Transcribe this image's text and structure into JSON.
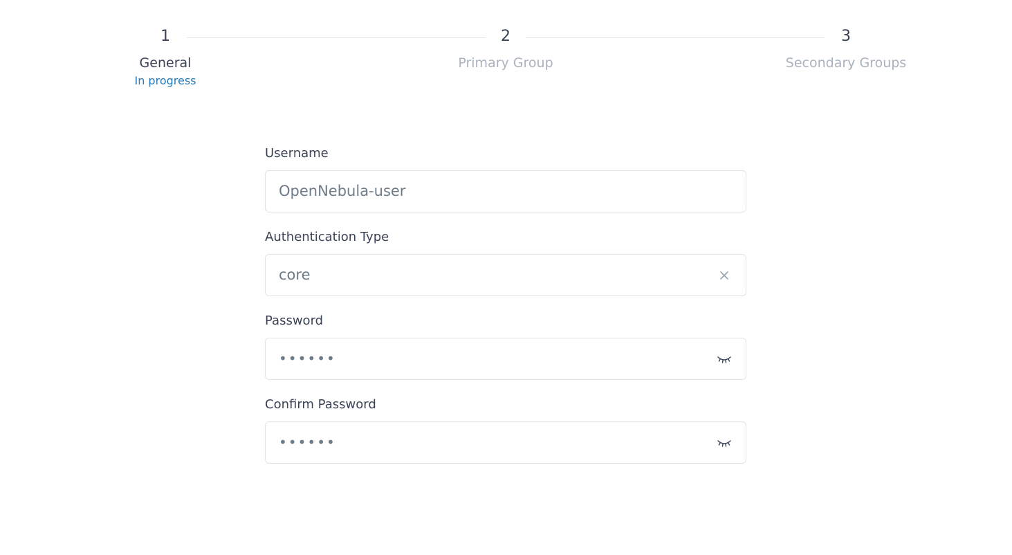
{
  "stepper": {
    "steps": [
      {
        "number": "1",
        "title": "General",
        "status": "In progress"
      },
      {
        "number": "2",
        "title": "Primary Group"
      },
      {
        "number": "3",
        "title": "Secondary Groups"
      }
    ]
  },
  "form": {
    "username": {
      "label": "Username",
      "value": "OpenNebula-user"
    },
    "auth_type": {
      "label": "Authentication Type",
      "value": "core",
      "icon": "close-icon"
    },
    "password": {
      "label": "Password",
      "value": "••••••",
      "icon": "eye-closed-icon"
    },
    "confirm_password": {
      "label": "Confirm Password",
      "value": "••••••",
      "icon": "eye-closed-icon"
    }
  },
  "colors": {
    "text": "#3a4256",
    "muted": "#a9b2bd",
    "accent": "#2a7ab5",
    "border": "#dfe3e8",
    "value": "#6e7b88"
  }
}
